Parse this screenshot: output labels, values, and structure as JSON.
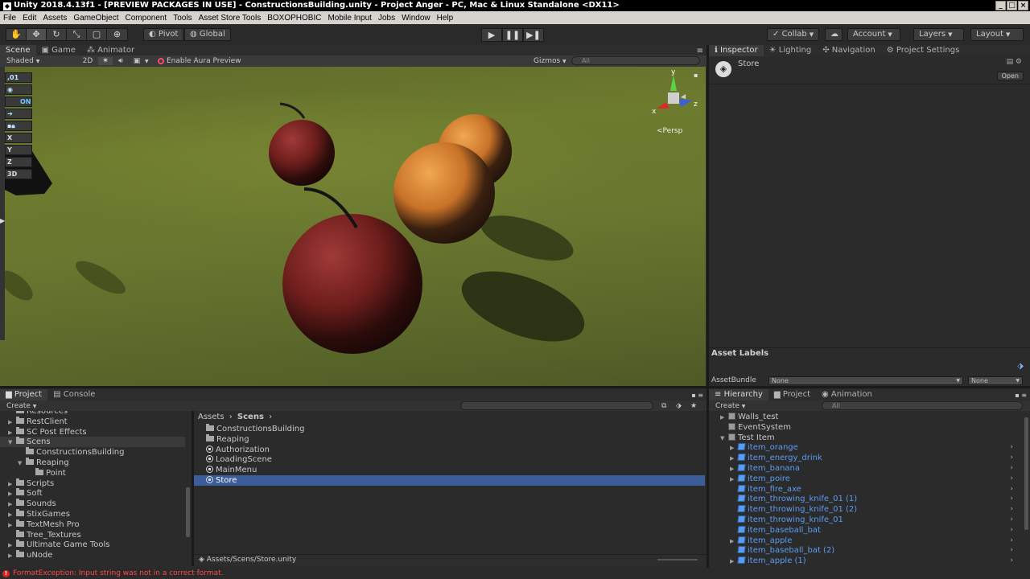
{
  "window": {
    "title": "Unity 2018.4.13f1 - [PREVIEW PACKAGES IN USE] - ConstructionsBuilding.unity - Project Anger - PC, Mac & Linux Standalone <DX11>"
  },
  "menu": [
    "File",
    "Edit",
    "Assets",
    "GameObject",
    "Component",
    "Tools",
    "Asset Store Tools",
    "BOXOPHOBIC",
    "Mobile Input",
    "Jobs",
    "Window",
    "Help"
  ],
  "toolbar": {
    "pivot": "Pivot",
    "global": "Global",
    "collab": "Collab",
    "account": "Account",
    "layers": "Layers",
    "layout": "Layout"
  },
  "sceneTabs": [
    "Scene",
    "Game",
    "Animator"
  ],
  "sceneToolbar": {
    "shading": "Shaded",
    "mode2d": "2D",
    "aura": "Enable Aura Preview",
    "gizmos": "Gizmos",
    "search": "All"
  },
  "gizmo": {
    "persp": "Persp",
    "y": "y",
    "x": "x",
    "z": "z"
  },
  "leftPanel": [
    ",01",
    "",
    "ON",
    "",
    "",
    "X",
    "Y",
    "Z",
    "3D"
  ],
  "inspectorTabs": [
    "Inspector",
    "Lighting",
    "Navigation",
    "Project Settings"
  ],
  "inspector": {
    "name": "Store",
    "open": "Open",
    "assetLabels": "Asset Labels",
    "assetBundle": "AssetBundle",
    "bundleValue": "None",
    "variantValue": "None"
  },
  "projectTabs": [
    "Project",
    "Console"
  ],
  "project": {
    "create": "Create",
    "tree": [
      {
        "label": "Resources",
        "depth": 1,
        "arrow": ""
      },
      {
        "label": "RestClient",
        "depth": 1,
        "arrow": "▶"
      },
      {
        "label": "SC Post Effects",
        "depth": 1,
        "arrow": "▶"
      },
      {
        "label": "Scens",
        "depth": 1,
        "arrow": "▼",
        "selected": true
      },
      {
        "label": "ConstructionsBuilding",
        "depth": 2,
        "arrow": ""
      },
      {
        "label": "Reaping",
        "depth": 2,
        "arrow": "▼"
      },
      {
        "label": "Point",
        "depth": 3,
        "arrow": ""
      },
      {
        "label": "Scripts",
        "depth": 1,
        "arrow": "▶"
      },
      {
        "label": "Soft",
        "depth": 1,
        "arrow": "▶"
      },
      {
        "label": "Sounds",
        "depth": 1,
        "arrow": "▶"
      },
      {
        "label": "StixGames",
        "depth": 1,
        "arrow": "▶"
      },
      {
        "label": "TextMesh Pro",
        "depth": 1,
        "arrow": "▶"
      },
      {
        "label": "Tree_Textures",
        "depth": 1,
        "arrow": ""
      },
      {
        "label": "Ultimate Game Tools",
        "depth": 1,
        "arrow": "▶"
      },
      {
        "label": "uNode",
        "depth": 1,
        "arrow": "▶"
      }
    ],
    "breadcrumb": [
      "Assets",
      "Scens"
    ],
    "files": [
      {
        "label": "ConstructionsBuilding",
        "kind": "folder"
      },
      {
        "label": "Reaping",
        "kind": "folder"
      },
      {
        "label": "Authorization",
        "kind": "scene"
      },
      {
        "label": "LoadingScene",
        "kind": "scene"
      },
      {
        "label": "MainMenu",
        "kind": "scene"
      },
      {
        "label": "Store",
        "kind": "scene",
        "selected": true
      }
    ],
    "path": "Assets/Scens/Store.unity"
  },
  "hierarchyTabs": [
    "Hierarchy",
    "Project",
    "Animation"
  ],
  "hierarchy": {
    "create": "Create",
    "search": "All",
    "items": [
      {
        "label": "Walls_test",
        "depth": 1,
        "arrow": "▶",
        "prefab": false
      },
      {
        "label": "EventSystem",
        "depth": 1,
        "arrow": "",
        "prefab": false
      },
      {
        "label": "Test Item",
        "depth": 1,
        "arrow": "▼",
        "prefab": false
      },
      {
        "label": "item_orange",
        "depth": 2,
        "arrow": "▶",
        "prefab": true
      },
      {
        "label": "item_energy_drink",
        "depth": 2,
        "arrow": "▶",
        "prefab": true
      },
      {
        "label": "item_banana",
        "depth": 2,
        "arrow": "▶",
        "prefab": true
      },
      {
        "label": "item_poire",
        "depth": 2,
        "arrow": "▶",
        "prefab": true
      },
      {
        "label": "item_fire_axe",
        "depth": 2,
        "arrow": "",
        "prefab": true
      },
      {
        "label": "item_throwing_knife_01 (1)",
        "depth": 2,
        "arrow": "",
        "prefab": true
      },
      {
        "label": "item_throwing_knife_01 (2)",
        "depth": 2,
        "arrow": "",
        "prefab": true
      },
      {
        "label": "item_throwing_knife_01",
        "depth": 2,
        "arrow": "",
        "prefab": true
      },
      {
        "label": "item_baseball_bat",
        "depth": 2,
        "arrow": "",
        "prefab": true
      },
      {
        "label": "item_apple",
        "depth": 2,
        "arrow": "▶",
        "prefab": true
      },
      {
        "label": "item_baseball_bat (2)",
        "depth": 2,
        "arrow": "",
        "prefab": true
      },
      {
        "label": "item_apple (1)",
        "depth": 2,
        "arrow": "▶",
        "prefab": true
      }
    ]
  },
  "status": {
    "message": "FormatException: Input string was not in a correct format."
  },
  "colors": {
    "accent": "#3b5d99",
    "prefab": "#5a9df0",
    "error": "#e02020"
  }
}
